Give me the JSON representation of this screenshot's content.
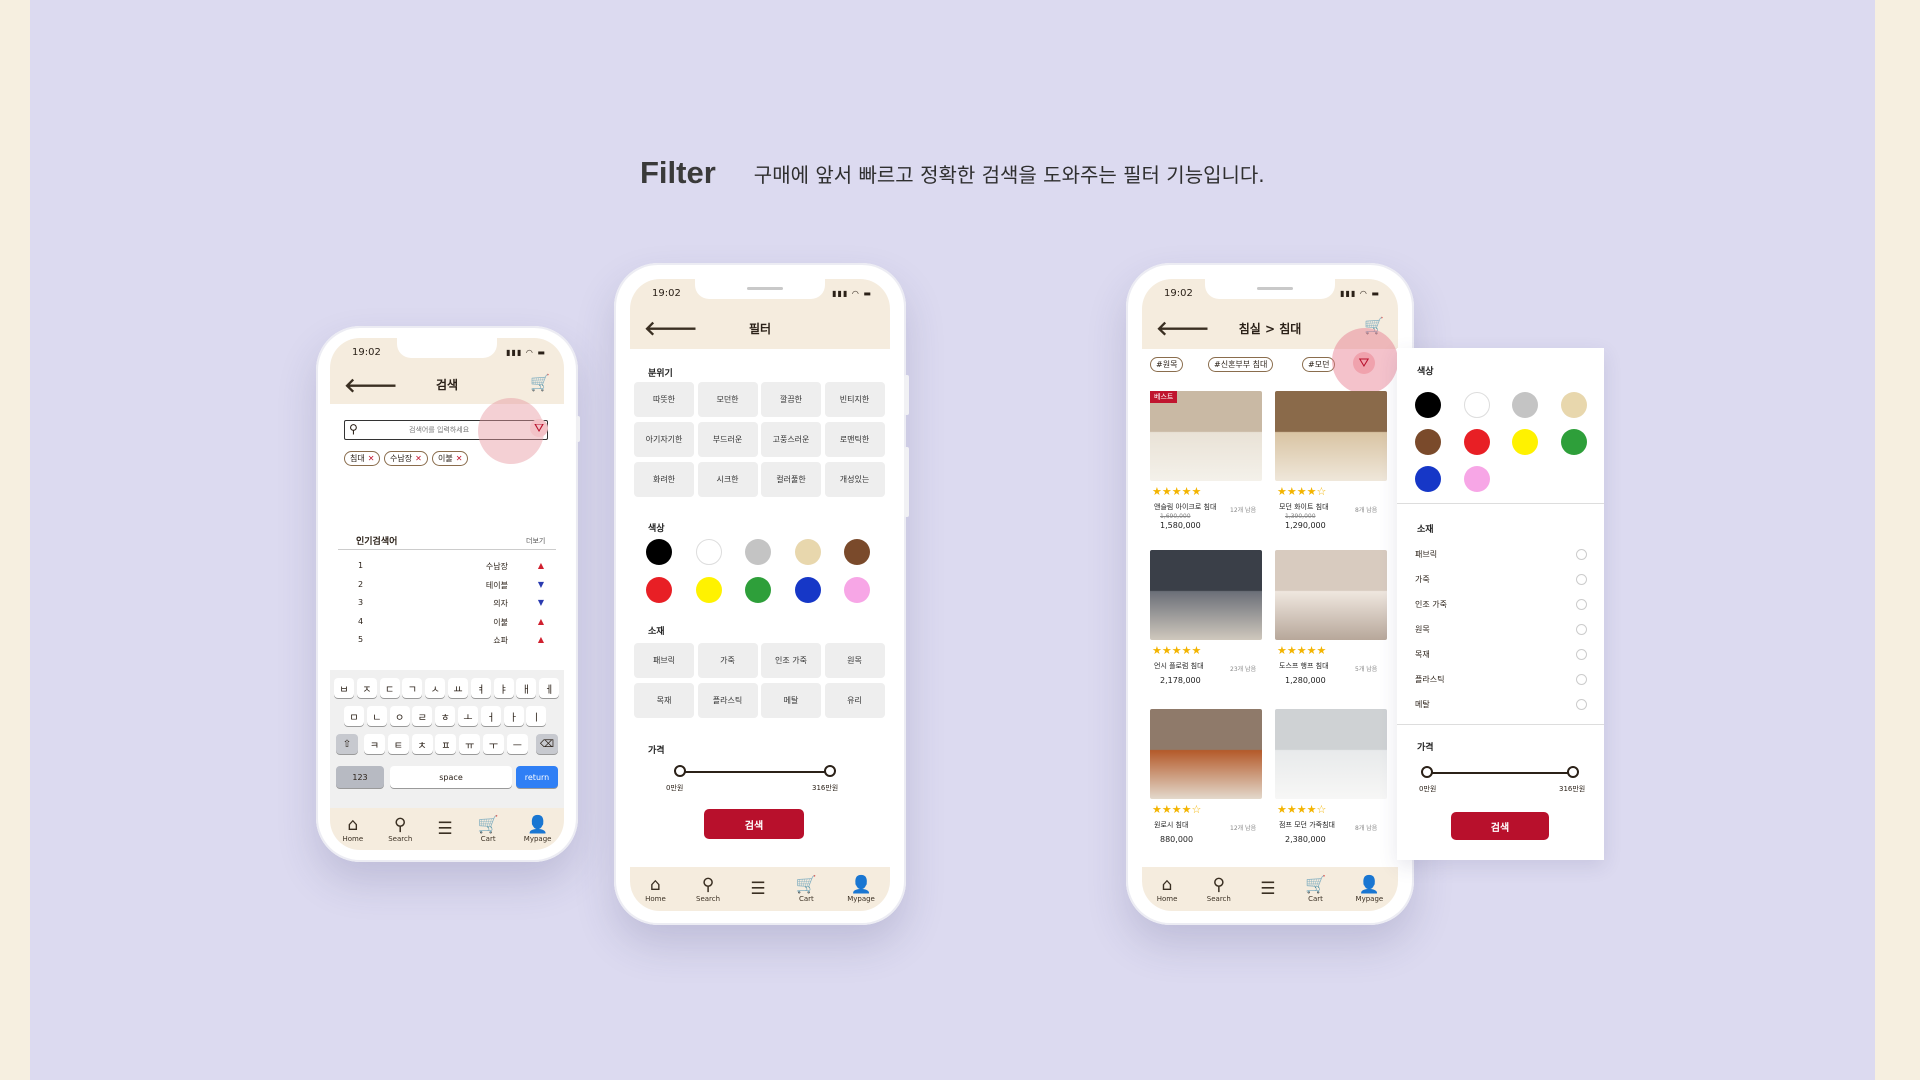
{
  "header": {
    "title": "Filter",
    "subtitle": "구매에 앞서 빠르고 정확한 검색을 도와주는 필터 기능입니다."
  },
  "status": {
    "time": "19:02"
  },
  "nav": [
    {
      "icon": "home-icon",
      "label": "Home"
    },
    {
      "icon": "search-icon",
      "label": "Search"
    },
    {
      "icon": "menu-icon",
      "label": ""
    },
    {
      "icon": "cart-icon",
      "label": "Cart"
    },
    {
      "icon": "user-icon",
      "label": "Mypage"
    }
  ],
  "phone1": {
    "title": "검색",
    "search_placeholder": "검색어를 입력하세요",
    "tags": [
      "침대",
      "수납장",
      "이불"
    ],
    "popular_title": "인기검색어",
    "more": "더보기",
    "ranks": [
      {
        "rank": "1",
        "term": "수납장",
        "trend": "up"
      },
      {
        "rank": "2",
        "term": "테이블",
        "trend": "down"
      },
      {
        "rank": "3",
        "term": "의자",
        "trend": "down"
      },
      {
        "rank": "4",
        "term": "이불",
        "trend": "up"
      },
      {
        "rank": "5",
        "term": "쇼파",
        "trend": "up"
      }
    ],
    "keyboard": {
      "row1": [
        "ㅂ",
        "ㅈ",
        "ㄷ",
        "ㄱ",
        "ㅅ",
        "ㅛ",
        "ㅕ",
        "ㅑ",
        "ㅐ",
        "ㅔ"
      ],
      "row2": [
        "ㅁ",
        "ㄴ",
        "ㅇ",
        "ㄹ",
        "ㅎ",
        "ㅗ",
        "ㅓ",
        "ㅏ",
        "ㅣ"
      ],
      "row3": [
        "ㅋ",
        "ㅌ",
        "ㅊ",
        "ㅍ",
        "ㅠ",
        "ㅜ",
        "ㅡ"
      ],
      "num": "123",
      "space": "space",
      "return": "return"
    }
  },
  "phone2": {
    "title": "필터",
    "mood_label": "분위기",
    "moods": [
      "따뜻한",
      "모던한",
      "깔끔한",
      "빈티지한",
      "아기자기한",
      "부드러운",
      "고풍스러운",
      "로맨틱한",
      "화려한",
      "시크한",
      "컬러풀한",
      "개성있는"
    ],
    "color_label": "색상",
    "colors": [
      "#000000",
      "#ffffff",
      "#c4c4c4",
      "#e8d7ad",
      "#7a4a2b",
      "#e81f25",
      "#fff200",
      "#2e9f3a",
      "#1637c7",
      "#f7a6e6"
    ],
    "material_label": "소재",
    "materials": [
      "패브릭",
      "가죽",
      "인조 가죽",
      "원목",
      "목재",
      "플라스틱",
      "메탈",
      "유리"
    ],
    "price_label": "가격",
    "price_min": "0만원",
    "price_max": "316만원",
    "search_btn": "검색"
  },
  "phone3": {
    "title": "침실 > 침대",
    "chips": [
      "#원목",
      "#신혼부부 침대",
      "#모던"
    ],
    "best_badge": "베스트",
    "products": [
      {
        "name": "앤슬림 아이크로 침대",
        "orig": "1,690,000",
        "price": "1,580,000",
        "left": "12개 남음",
        "stars": 5
      },
      {
        "name": "모던 화이트 침대",
        "orig": "1,390,000",
        "price": "1,290,000",
        "left": "8개 남음",
        "stars": 4
      },
      {
        "name": "언시 플로럼 침대",
        "orig": "",
        "price": "2,178,000",
        "left": "23개 남음",
        "stars": 5
      },
      {
        "name": "도스프 행프 침대",
        "orig": "",
        "price": "1,280,000",
        "left": "5개 남음",
        "stars": 5
      },
      {
        "name": "원로시 침대",
        "orig": "",
        "price": "880,000",
        "left": "12개 남음",
        "stars": 4
      },
      {
        "name": "점프 모던 가죽침대",
        "orig": "",
        "price": "2,380,000",
        "left": "8개 남음",
        "stars": 4
      }
    ],
    "panel": {
      "color_label": "색상",
      "material_label": "소재",
      "materials": [
        "패브릭",
        "가죽",
        "인조 가죽",
        "원목",
        "목재",
        "플라스틱",
        "메탈"
      ],
      "price_label": "가격",
      "price_min": "0만원",
      "price_max": "316만원",
      "search_btn": "검색"
    }
  }
}
